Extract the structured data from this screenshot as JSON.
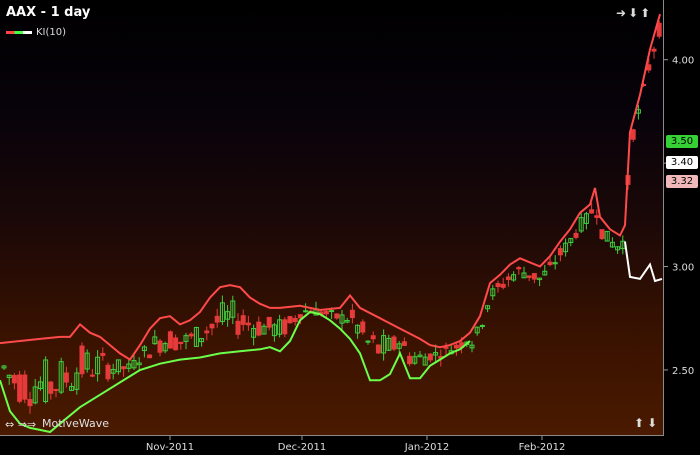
{
  "header": {
    "title": "AAX - 1 day",
    "indicator_label": "KI(10)",
    "brand": "MotiveWave"
  },
  "colors": {
    "up_candle": "#3ecf3e",
    "down_candle": "#e63b3b",
    "ki_red": "#ff4a4a",
    "ki_green": "#6aff4a",
    "ki_white": "#ffffff",
    "badge_green": "#35d135",
    "badge_white": "#ffffff",
    "badge_pink": "#f0b8b8"
  },
  "chart_data": {
    "type": "candlestick",
    "title": "AAX - 1 day",
    "x_ticks": [
      "Nov-2011",
      "Dec-2011",
      "Jan-2012",
      "Feb-2012"
    ],
    "y_ticks": [
      "2.50",
      "3.00",
      "3.50",
      "4.00"
    ],
    "ylim": [
      2.2,
      4.25
    ],
    "grid": false,
    "value_badges": [
      "3.50",
      "3.40",
      "3.32"
    ],
    "series": [
      {
        "name": "KI(10)",
        "type": "line"
      }
    ],
    "ki_upper": [
      [
        0,
        2.63
      ],
      [
        20,
        2.64
      ],
      [
        40,
        2.65
      ],
      [
        60,
        2.66
      ],
      [
        70,
        2.66
      ],
      [
        80,
        2.72
      ],
      [
        90,
        2.68
      ],
      [
        100,
        2.66
      ],
      [
        110,
        2.62
      ],
      [
        120,
        2.58
      ],
      [
        130,
        2.55
      ],
      [
        140,
        2.62
      ],
      [
        150,
        2.7
      ],
      [
        160,
        2.75
      ],
      [
        170,
        2.76
      ],
      [
        180,
        2.72
      ],
      [
        190,
        2.74
      ],
      [
        200,
        2.78
      ],
      [
        210,
        2.85
      ],
      [
        220,
        2.9
      ],
      [
        230,
        2.91
      ],
      [
        240,
        2.9
      ],
      [
        250,
        2.85
      ],
      [
        260,
        2.82
      ],
      [
        270,
        2.8
      ],
      [
        280,
        2.8
      ],
      [
        300,
        2.81
      ],
      [
        320,
        2.79
      ],
      [
        340,
        2.8
      ],
      [
        350,
        2.86
      ],
      [
        360,
        2.8
      ],
      [
        380,
        2.75
      ],
      [
        400,
        2.7
      ],
      [
        420,
        2.65
      ],
      [
        430,
        2.62
      ],
      [
        440,
        2.61
      ],
      [
        450,
        2.62
      ],
      [
        460,
        2.64
      ],
      [
        470,
        2.68
      ],
      [
        480,
        2.76
      ],
      [
        490,
        2.92
      ],
      [
        500,
        2.96
      ],
      [
        510,
        3.01
      ],
      [
        520,
        3.04
      ],
      [
        530,
        3.02
      ],
      [
        540,
        3.0
      ],
      [
        550,
        3.05
      ],
      [
        560,
        3.12
      ],
      [
        570,
        3.18
      ],
      [
        580,
        3.26
      ],
      [
        590,
        3.3
      ],
      [
        595,
        3.38
      ],
      [
        600,
        3.24
      ],
      [
        610,
        3.18
      ],
      [
        620,
        3.15
      ],
      [
        625,
        3.2
      ],
      [
        630,
        3.65
      ],
      [
        640,
        3.83
      ],
      [
        650,
        4.05
      ],
      [
        660,
        4.22
      ]
    ],
    "ki_lower": [
      [
        0,
        2.45
      ],
      [
        10,
        2.3
      ],
      [
        20,
        2.24
      ],
      [
        30,
        2.22
      ],
      [
        40,
        2.21
      ],
      [
        50,
        2.2
      ],
      [
        60,
        2.24
      ],
      [
        80,
        2.32
      ],
      [
        100,
        2.38
      ],
      [
        120,
        2.44
      ],
      [
        140,
        2.5
      ],
      [
        160,
        2.53
      ],
      [
        180,
        2.55
      ],
      [
        200,
        2.56
      ],
      [
        220,
        2.58
      ],
      [
        240,
        2.59
      ],
      [
        260,
        2.6
      ],
      [
        270,
        2.61
      ],
      [
        280,
        2.59
      ],
      [
        290,
        2.64
      ],
      [
        300,
        2.74
      ],
      [
        310,
        2.78
      ],
      [
        320,
        2.77
      ],
      [
        330,
        2.74
      ],
      [
        340,
        2.7
      ],
      [
        350,
        2.65
      ],
      [
        360,
        2.58
      ],
      [
        370,
        2.45
      ],
      [
        380,
        2.45
      ],
      [
        390,
        2.48
      ],
      [
        400,
        2.58
      ],
      [
        410,
        2.46
      ],
      [
        420,
        2.46
      ],
      [
        430,
        2.52
      ],
      [
        440,
        2.55
      ],
      [
        450,
        2.58
      ],
      [
        460,
        2.6
      ],
      [
        470,
        2.64
      ]
    ],
    "ki_projection": [
      [
        625,
        3.12
      ],
      [
        630,
        2.95
      ],
      [
        640,
        2.94
      ],
      [
        650,
        3.01
      ],
      [
        655,
        2.93
      ],
      [
        662,
        2.94
      ]
    ]
  }
}
